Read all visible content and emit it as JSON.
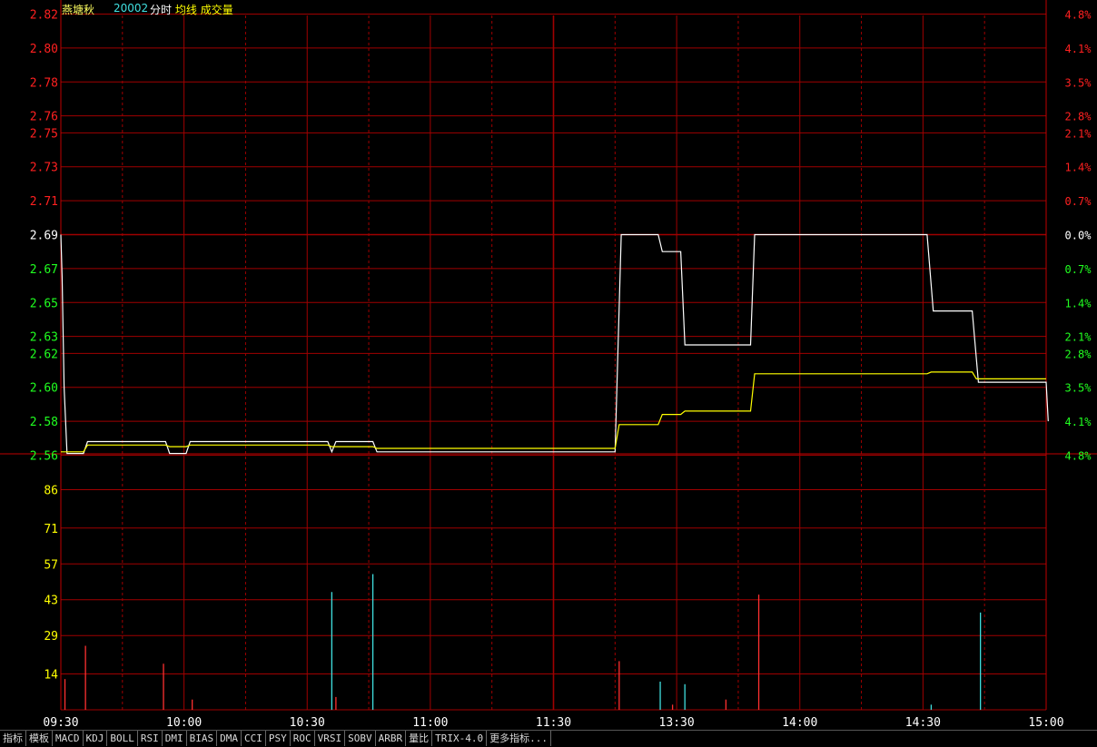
{
  "header": {
    "stock_name": "燕塘秋",
    "stock_code": "20002",
    "legend_items": [
      {
        "label": "分时",
        "color": "#ffffff"
      },
      {
        "label": "均线",
        "color": "#ffff00"
      },
      {
        "label": "成交量",
        "color": "#ffff00"
      }
    ]
  },
  "colors": {
    "up": "#ff2020",
    "down": "#20ff20",
    "flat": "#ffffff",
    "grid": "#a00000",
    "price_line": "#ffffff",
    "avg_line": "#ffff00",
    "vol_up": "#ff3030",
    "vol_down": "#40e0e0",
    "vol_label": "#ffff00",
    "time_label": "#ffffff"
  },
  "chart_data": [
    {
      "type": "line",
      "name": "price",
      "prev_close": 2.69,
      "ylim": [
        2.5608,
        2.8192
      ],
      "price_ticks": [
        2.82,
        2.8,
        2.78,
        2.76,
        2.75,
        2.73,
        2.71,
        2.69,
        2.67,
        2.65,
        2.63,
        2.62,
        2.6,
        2.58,
        2.56
      ],
      "pct_ticks": [
        "4.8%",
        "4.1%",
        "3.5%",
        "2.8%",
        "2.1%",
        "1.4%",
        "0.7%",
        "0.0%",
        "0.7%",
        "1.4%",
        "2.1%",
        "2.8%",
        "3.5%",
        "4.1%",
        "4.8%"
      ],
      "x_labels": [
        "09:30",
        "10:00",
        "10:30",
        "11:00",
        "11:30",
        "13:30",
        "14:00",
        "14:30",
        "15:00"
      ],
      "total_minutes": 240,
      "series": [
        {
          "key": "price",
          "points": [
            [
              0,
              2.69
            ],
            [
              0.3,
              2.665
            ],
            [
              0.8,
              2.6
            ],
            [
              1.5,
              2.561
            ],
            [
              5.5,
              2.561
            ],
            [
              6.5,
              2.568
            ],
            [
              25.5,
              2.568
            ],
            [
              26.5,
              2.561
            ],
            [
              30.5,
              2.561
            ],
            [
              31.5,
              2.568
            ],
            [
              65,
              2.568
            ],
            [
              66,
              2.562
            ],
            [
              67,
              2.568
            ],
            [
              76,
              2.568
            ],
            [
              77,
              2.562
            ],
            [
              135,
              2.562
            ],
            [
              136.5,
              2.69
            ],
            [
              145.5,
              2.69
            ],
            [
              146.5,
              2.68
            ],
            [
              151,
              2.68
            ],
            [
              152,
              2.625
            ],
            [
              168,
              2.625
            ],
            [
              169,
              2.69
            ],
            [
              211,
              2.69
            ],
            [
              212.5,
              2.645
            ],
            [
              222,
              2.645
            ],
            [
              223.5,
              2.603
            ],
            [
              240,
              2.603
            ],
            [
              240.5,
              2.58
            ]
          ]
        },
        {
          "key": "avg",
          "points": [
            [
              0,
              2.562
            ],
            [
              1.5,
              2.562
            ],
            [
              5.5,
              2.562
            ],
            [
              6.5,
              2.566
            ],
            [
              25.5,
              2.566
            ],
            [
              26.5,
              2.565
            ],
            [
              30.5,
              2.565
            ],
            [
              31.5,
              2.566
            ],
            [
              65,
              2.566
            ],
            [
              66,
              2.565
            ],
            [
              67,
              2.565
            ],
            [
              76,
              2.565
            ],
            [
              77,
              2.564
            ],
            [
              135,
              2.564
            ],
            [
              136,
              2.578
            ],
            [
              145.5,
              2.578
            ],
            [
              146.5,
              2.584
            ],
            [
              151,
              2.584
            ],
            [
              152,
              2.586
            ],
            [
              168,
              2.586
            ],
            [
              169,
              2.608
            ],
            [
              211,
              2.608
            ],
            [
              212,
              2.609
            ],
            [
              222,
              2.609
            ],
            [
              223,
              2.605
            ],
            [
              240,
              2.605
            ]
          ]
        }
      ]
    },
    {
      "type": "bar",
      "name": "volume",
      "ylim": [
        0,
        100
      ],
      "vol_ticks": [
        86,
        71,
        57,
        43,
        29,
        14
      ],
      "bars": [
        {
          "t": 1,
          "v": 12,
          "dir": "up"
        },
        {
          "t": 6,
          "v": 25,
          "dir": "up"
        },
        {
          "t": 25,
          "v": 18,
          "dir": "up"
        },
        {
          "t": 32,
          "v": 4,
          "dir": "up"
        },
        {
          "t": 66,
          "v": 46,
          "dir": "down"
        },
        {
          "t": 67,
          "v": 5,
          "dir": "up"
        },
        {
          "t": 76,
          "v": 53,
          "dir": "down"
        },
        {
          "t": 136,
          "v": 19,
          "dir": "up"
        },
        {
          "t": 146,
          "v": 11,
          "dir": "down"
        },
        {
          "t": 149,
          "v": 2,
          "dir": "up"
        },
        {
          "t": 152,
          "v": 10,
          "dir": "down"
        },
        {
          "t": 162,
          "v": 4,
          "dir": "up"
        },
        {
          "t": 170,
          "v": 45,
          "dir": "up"
        },
        {
          "t": 212,
          "v": 2,
          "dir": "down"
        },
        {
          "t": 224,
          "v": 38,
          "dir": "down"
        }
      ]
    }
  ],
  "tabs": [
    "指标",
    "模板",
    "MACD",
    "KDJ",
    "BOLL",
    "RSI",
    "DMI",
    "BIAS",
    "DMA",
    "CCI",
    "PSY",
    "ROC",
    "VRSI",
    "SOBV",
    "ARBR",
    "量比",
    "TRIX-4.0",
    "更多指标..."
  ]
}
